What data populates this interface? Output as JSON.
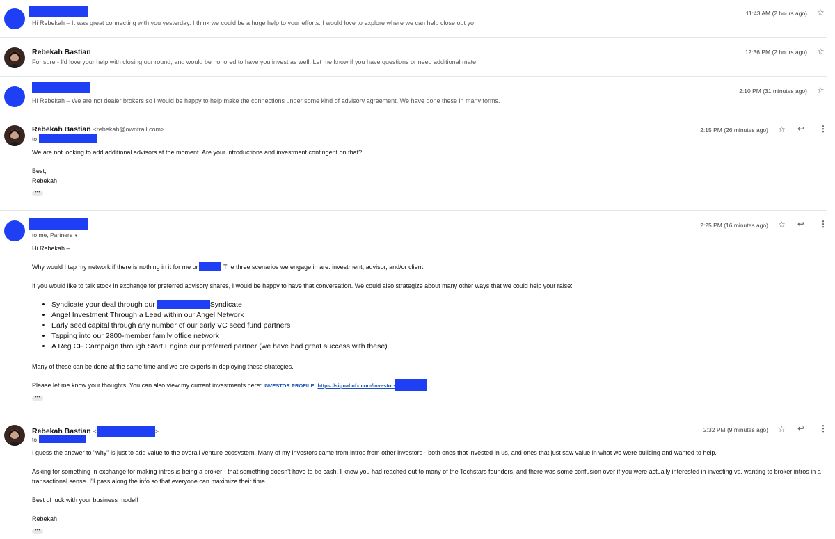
{
  "messages": [
    {
      "snippet": "Hi Rebekah – It was great connecting with you yesterday. I think we could be a huge help to your efforts. I would love to explore where we can help close out yo",
      "time": "11:43 AM (2 hours ago)"
    },
    {
      "sender": "Rebekah Bastian",
      "snippet": "For sure - I'd love your help with closing our round, and would be honored to have you invest as well. Let me know if you have questions or need additional mate",
      "time": "12:36 PM (2 hours ago)"
    },
    {
      "snippet": "Hi Rebekah – We are not dealer brokers so I would be happy to help make the connections under some kind of advisory agreement. We have done these in many forms.",
      "time": "2:10 PM (31 minutes ago)"
    },
    {
      "sender": "Rebekah Bastian",
      "sender_email": "<rebekah@owntrail.com>",
      "to": "to",
      "time": "2:15 PM (26 minutes ago)",
      "lines": [
        "We are not looking to add additional advisors at the moment. Are your introductions and investment contingent on that?",
        "Best,",
        "Rebekah"
      ]
    },
    {
      "to": "to me, Partners",
      "time": "2:25 PM (16 minutes ago)",
      "greeting": "Hi Rebekah –",
      "p1_a": "Why would I tap my network if there is nothing in it for me or",
      "p1_b": "The three scenarios we engage in are: investment, advisor, and/or client.",
      "p2": "If you would like to talk stock in exchange for preferred advisory shares, I would be happy to have that conversation.  We could also strategize about many other ways that we could help your raise:",
      "bullet1_a": "Syndicate your deal through our",
      "bullet1_b": "Syndicate",
      "bullets": [
        "Angel Investment Through a Lead within our Angel Network",
        "Early seed capital through any number of our early VC seed fund partners",
        "Tapping into our 2800-member family office network",
        "A Reg CF Campaign through Start Engine our preferred partner (we have had great success with these)"
      ],
      "p3": "Many of these can be done at the same time and we are experts in deploying these strategies.",
      "p4": "Please let me know your thoughts.  You can also view my current investments here:",
      "profile_label": "INVESTOR PROFILE:",
      "profile_link": "https://signal.nfx.com/investors/"
    },
    {
      "sender": "Rebekah Bastian",
      "sender_email_open": "<",
      "sender_email_close": ">",
      "to": "to",
      "time": "2:32 PM (9 minutes ago)",
      "lines": [
        "I guess the answer to \"why\" is just to add value to the overall venture ecosystem. Many of my investors came from intros from other investors - both ones that invested in us, and ones that just saw value in what we were building and wanted to help.",
        "Asking for something in exchange for making intros",
        "is",
        "being a broker - that something doesn't have to be cash. I know you had reached out to many of the Techstars founders, and there was some confusion over if you were actually interested in investing vs. wanting to broker intros in a",
        "transactional sense. I'll pass along the info so that everyone can maximize their time.",
        "Best of luck with your business model!",
        "Rebekah"
      ]
    }
  ],
  "icons": {
    "star": "star-icon",
    "reply": "reply-icon",
    "more": "more-vert-icon",
    "ellipsis": "show-trimmed-content-icon"
  },
  "colors": {
    "redaction": "#1f3ff5",
    "link": "#1a56b8"
  }
}
